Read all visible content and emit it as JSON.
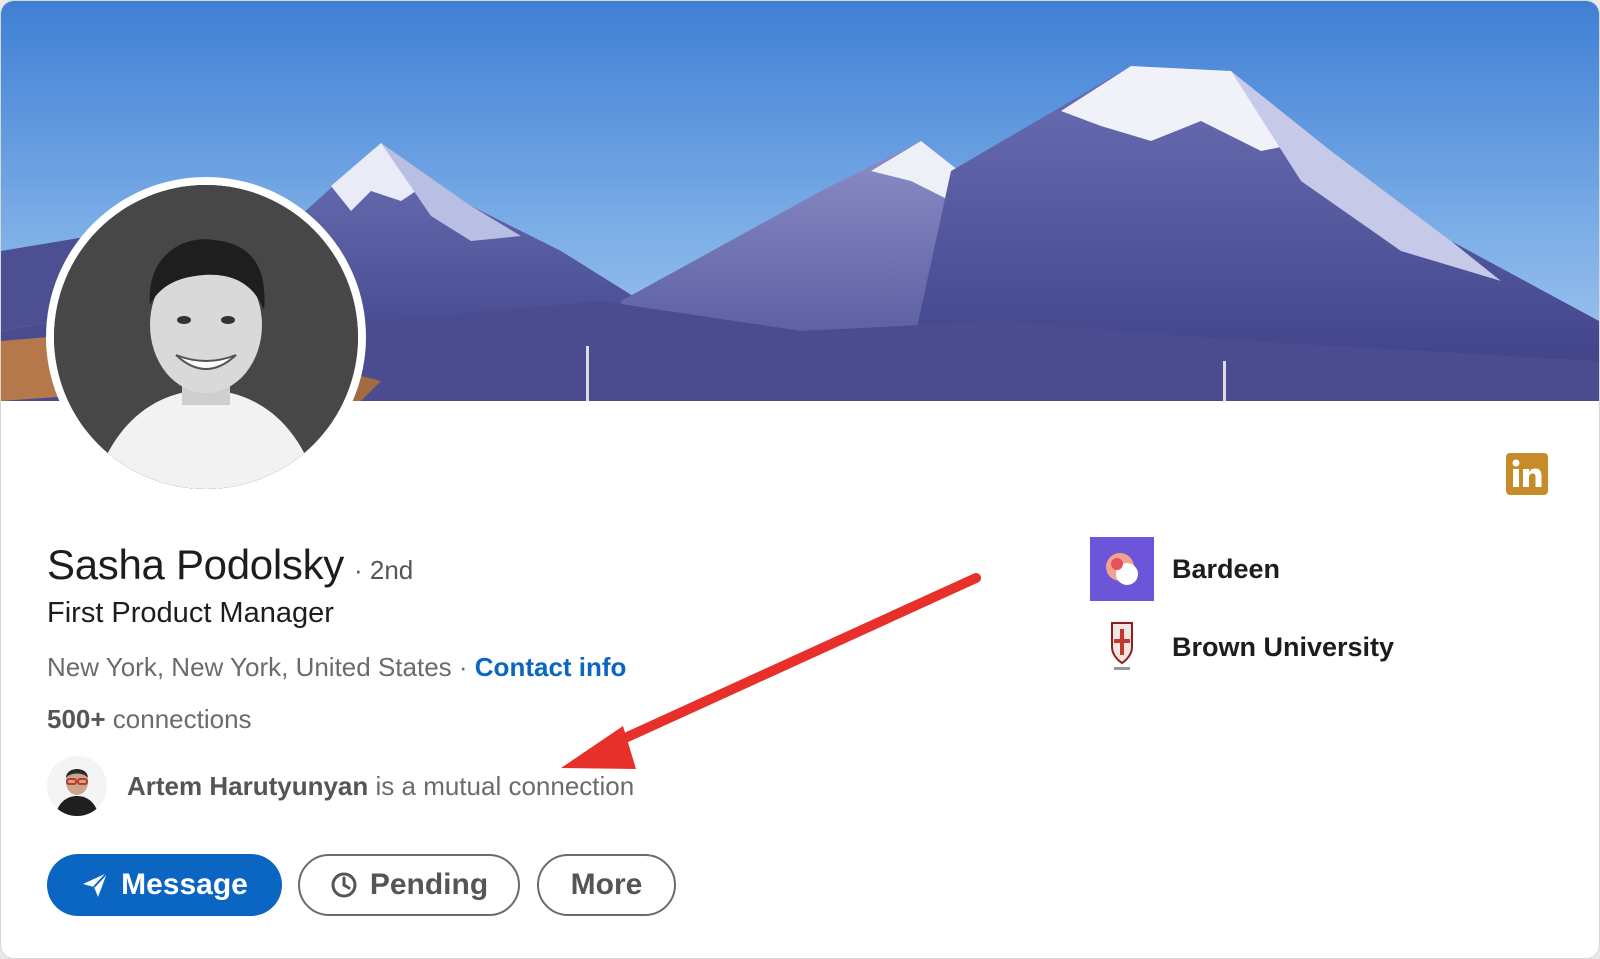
{
  "profile": {
    "name": "Sasha Podolsky",
    "degree": "· 2nd",
    "headline": "First Product Manager",
    "location": "New York, New York, United States",
    "separator": " · ",
    "contact_info_label": "Contact info",
    "connections_count": "500+",
    "connections_label": " connections",
    "mutual_name": "Artem Harutyunyan",
    "mutual_suffix": " is a mutual connection"
  },
  "actions": {
    "message_label": "Message",
    "message_icon": "send-icon",
    "pending_label": "Pending",
    "pending_icon": "clock-icon",
    "more_label": "More"
  },
  "sidebar": {
    "items": [
      {
        "label": "Bardeen",
        "icon": "bardeen-logo"
      },
      {
        "label": "Brown University",
        "icon": "brown-university-logo"
      }
    ]
  },
  "badges": {
    "linkedin_icon": "linkedin-icon"
  },
  "colors": {
    "accent": "#0a66c2",
    "annotation_arrow": "#e8302a",
    "linkedin_badge": "#c78b2a",
    "bardeen_logo_bg": "#6c55d9"
  }
}
